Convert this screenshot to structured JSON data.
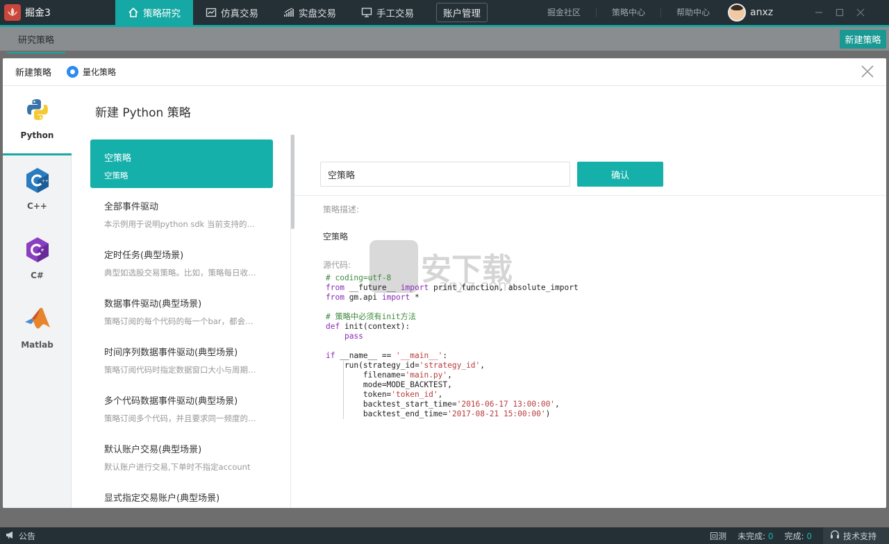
{
  "app": {
    "name": "掘金3"
  },
  "nav": {
    "tabs": [
      {
        "label": "策略研究",
        "icon": "house-icon",
        "active": true
      },
      {
        "label": "仿真交易",
        "icon": "chart-window-icon"
      },
      {
        "label": "实盘交易",
        "icon": "trend-bars-icon"
      },
      {
        "label": "手工交易",
        "icon": "monitor-icon"
      }
    ],
    "account_button": "账户管理",
    "links": [
      "掘金社区",
      "策略中心",
      "帮助中心"
    ],
    "user": "anxz"
  },
  "subbar": {
    "tab": "研究策略",
    "new_button": "新建策略"
  },
  "modal": {
    "title": "新建策略",
    "radio_label": "量化策略",
    "panel_title": "新建 Python 策略",
    "languages": [
      {
        "name": "Python",
        "icon": "python-icon",
        "active": true
      },
      {
        "name": "C++",
        "icon": "cpp-icon"
      },
      {
        "name": "C#",
        "icon": "csharp-icon"
      },
      {
        "name": "Matlab",
        "icon": "matlab-icon"
      }
    ],
    "templates": [
      {
        "title": "空策略",
        "desc": "空策略",
        "active": true
      },
      {
        "title": "全部事件驱动",
        "desc": "本示例用于说明python sdk 当前支持的回..."
      },
      {
        "title": "定时任务(典型场景)",
        "desc": "典型如选股交易策略。比如，策略每日收盘..."
      },
      {
        "title": "数据事件驱动(典型场景)",
        "desc": "策略订阅的每个代码的每一个bar，都会触..."
      },
      {
        "title": "时间序列数据事件驱动(典型场景)",
        "desc": "策略订阅代码时指定数据窗口大小与周期，..."
      },
      {
        "title": "多个代码数据事件驱动(典型场景)",
        "desc": "策略订阅多个代码，并且要求同一频度的数..."
      },
      {
        "title": "默认账户交易(典型场景)",
        "desc": "默认账户进行交易,下单时不指定account"
      },
      {
        "title": "显式指定交易账户(典型场景)",
        "desc": ""
      }
    ],
    "detail": {
      "name_value": "空策略",
      "confirm": "确认",
      "desc_label": "策略描述:",
      "desc_value": "空策略",
      "code_label": "源代码:",
      "watermark_text": "安下载",
      "watermark_sub": "anxz.com"
    }
  },
  "status": {
    "notice": "公告",
    "backtest": "回测",
    "pending_label": "未完成:",
    "pending_count": "0",
    "done_label": "完成:",
    "done_count": "0",
    "support": "技术支持"
  },
  "colors": {
    "accent": "#16b0ab",
    "topbar": "#253036",
    "radio": "#2b8bf0"
  }
}
